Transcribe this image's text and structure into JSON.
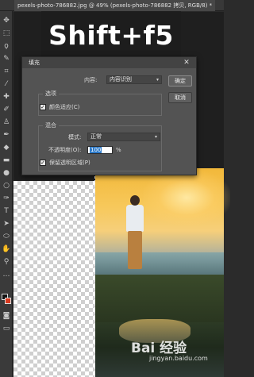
{
  "document_tab": {
    "label": "pexels-photo-786882.jpg @ 49% (pexels-photo-786882 拷贝, RGB/8) *"
  },
  "hotkey_overlay": {
    "text": "Shift+f5"
  },
  "toolbar": {
    "icons": [
      "move-tool-icon",
      "marquee-tool-icon",
      "lasso-tool-icon",
      "quick-select-tool-icon",
      "crop-tool-icon",
      "eyedropper-tool-icon",
      "healing-brush-icon",
      "brush-tool-icon",
      "clone-stamp-icon",
      "history-brush-icon",
      "eraser-tool-icon",
      "gradient-tool-icon",
      "blur-tool-icon",
      "dodge-tool-icon",
      "pen-tool-icon",
      "type-tool-icon",
      "path-select-icon",
      "shape-tool-icon",
      "hand-tool-icon",
      "zoom-tool-icon"
    ],
    "foreground_color": "#111111",
    "background_color": "#d8391f"
  },
  "fill_dialog": {
    "title": "填充",
    "contents_label": "内容:",
    "contents_value": "内容识别",
    "options_group": "选项",
    "color_adapt_label": "颜色适应(C)",
    "color_adapt_checked": true,
    "blending_group": "混合",
    "mode_label": "模式:",
    "mode_value": "正常",
    "opacity_label": "不透明度(O):",
    "opacity_value": "100",
    "opacity_unit": "%",
    "preserve_transparency_label": "保留透明区域(P)",
    "preserve_transparency_checked": true,
    "ok_label": "确定",
    "cancel_label": "取消"
  },
  "watermark": {
    "brand": "Bai 经验",
    "url": "jingyan.baidu.com"
  }
}
